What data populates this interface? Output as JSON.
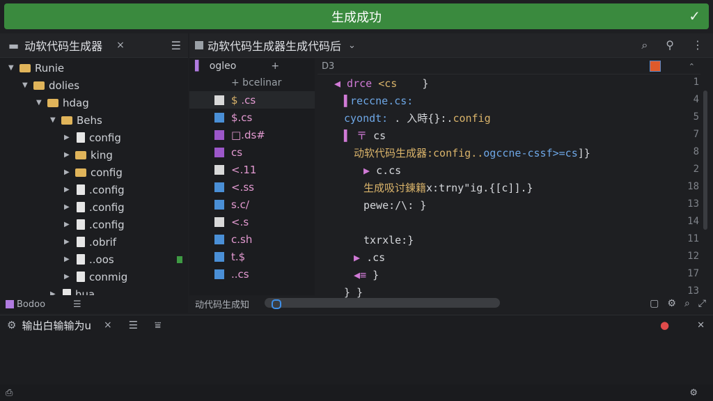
{
  "banner": {
    "text": "生成成功",
    "check_icon": "✓"
  },
  "left_panel": {
    "title": "动软代码生成器",
    "close": "×",
    "menu": "☰",
    "tree": [
      {
        "label": "Runie",
        "depth": 0,
        "kind": "folder",
        "arrow": "▼"
      },
      {
        "label": "dolies",
        "depth": 1,
        "kind": "folder",
        "arrow": "▼"
      },
      {
        "label": "hdag",
        "depth": 2,
        "kind": "folder",
        "arrow": "▼"
      },
      {
        "label": "Behs",
        "depth": 3,
        "kind": "folder",
        "arrow": "▼"
      },
      {
        "label": "config",
        "depth": 4,
        "kind": "file",
        "arrow": "▶"
      },
      {
        "label": "king",
        "depth": 4,
        "kind": "folder",
        "arrow": "▶"
      },
      {
        "label": "config",
        "depth": 4,
        "kind": "folder",
        "arrow": "▶"
      },
      {
        "label": ".config",
        "depth": 4,
        "kind": "file",
        "arrow": "▶"
      },
      {
        "label": ".config",
        "depth": 4,
        "kind": "file",
        "arrow": "▶"
      },
      {
        "label": ".config",
        "depth": 4,
        "kind": "file",
        "arrow": "▶"
      },
      {
        "label": ".obrif",
        "depth": 4,
        "kind": "file",
        "arrow": "▶"
      },
      {
        "label": "..oos",
        "depth": 4,
        "kind": "file",
        "arrow": "▶"
      },
      {
        "label": "conmig",
        "depth": 4,
        "kind": "file",
        "arrow": "▶"
      },
      {
        "label": "hua",
        "depth": 3,
        "kind": "file",
        "arrow": "▶"
      }
    ],
    "footer": {
      "label": "Bodoo",
      "menu": "☰"
    }
  },
  "editor_tab": {
    "title": "动软代码生成器生成代码后",
    "chevron": "⌄"
  },
  "structure": {
    "header": "ogleo",
    "header_plus": "+",
    "subheader": "+ bcelinar",
    "rows": [
      {
        "icon": "file",
        "prefix": "$",
        "kind": ".cs"
      },
      {
        "icon": "blue",
        "prefix": "",
        "kind": "$.cs"
      },
      {
        "icon": "purple",
        "prefix": "",
        "kind": "□.ds#"
      },
      {
        "icon": "purple",
        "prefix": "",
        "kind": "cs"
      },
      {
        "icon": "file",
        "prefix": "",
        "kind": "<.11"
      },
      {
        "icon": "blue",
        "prefix": "",
        "kind": "<.ss"
      },
      {
        "icon": "blue",
        "prefix": "",
        "kind": "s.c/"
      },
      {
        "icon": "file",
        "prefix": "",
        "kind": "<.s"
      },
      {
        "icon": "blue",
        "prefix": "",
        "kind": "c.sh"
      },
      {
        "icon": "blue",
        "prefix": "",
        "kind": "t.$"
      },
      {
        "icon": "blue",
        "prefix": "",
        "kind": "..cs"
      }
    ]
  },
  "editor": {
    "header": "D3",
    "lines": [
      {
        "indent": 1,
        "parts": [
          [
            "kw",
            "◀ drce "
          ],
          [
            "tx",
            "<cs"
          ],
          [
            "wh",
            "    }"
          ]
        ]
      },
      {
        "indent": 2,
        "parts": [
          [
            "kw",
            "▌"
          ],
          [
            "bl",
            "reccne.cs:"
          ]
        ]
      },
      {
        "indent": 2,
        "parts": [
          [
            "bl",
            "cyondt:"
          ],
          [
            "wh",
            " . 入時{}:."
          ],
          [
            "tx",
            "config"
          ]
        ]
      },
      {
        "indent": 2,
        "parts": [
          [
            "kw",
            "▌ 〒 "
          ],
          [
            "wh",
            "cs"
          ]
        ]
      },
      {
        "indent": 3,
        "parts": [
          [
            "tx",
            "动软代码生成器:config.."
          ],
          [
            "bl",
            "ogccne-cssf>=cs"
          ],
          [
            "wh",
            "]}"
          ]
        ]
      },
      {
        "indent": 4,
        "parts": [
          [
            "kw",
            "▶ "
          ],
          [
            "wh",
            "c.cs"
          ]
        ]
      },
      {
        "indent": 4,
        "parts": [
          [
            "tx",
            "生成吸讨鍊籍"
          ],
          [
            "wh",
            "x:trny\"ig.{[c]].}"
          ]
        ]
      },
      {
        "indent": 4,
        "parts": [
          [
            "wh",
            "pewe:/\\: }"
          ]
        ]
      },
      {
        "indent": 4,
        "parts": [
          [
            "wh",
            ""
          ]
        ]
      },
      {
        "indent": 4,
        "parts": [
          [
            "wh",
            "txrxle:}"
          ]
        ]
      },
      {
        "indent": 3,
        "parts": [
          [
            "kw",
            "▶ "
          ],
          [
            "wh",
            ".cs"
          ]
        ]
      },
      {
        "indent": 3,
        "parts": [
          [
            "kw",
            "◀≡ "
          ],
          [
            "wh",
            "}"
          ]
        ]
      },
      {
        "indent": 2,
        "parts": [
          [
            "wh",
            "} }"
          ]
        ]
      }
    ],
    "gutter": [
      "1",
      "4",
      "5",
      "7",
      "8",
      "2",
      "18",
      "13",
      "14",
      "11",
      "12",
      "17",
      "13"
    ]
  },
  "editor_footer": {
    "label": "动代码生成知"
  },
  "output": {
    "title": "输出白输输为u",
    "close": "×",
    "menu": "☰"
  },
  "colors": {
    "banner": "#3a8a3e",
    "accent": "#3f8fe8"
  }
}
